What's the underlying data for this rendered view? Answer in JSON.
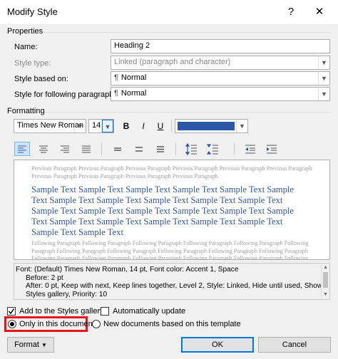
{
  "window": {
    "title": "Modify Style",
    "help": "?",
    "close": "✕"
  },
  "properties": {
    "section_label": "Properties",
    "name_label": "Name:",
    "name_value": "Heading 2",
    "style_type_label": "Style type:",
    "style_type_value": "Linked (paragraph and character)",
    "based_on_label": "Style based on:",
    "based_on_value": "Normal",
    "following_label": "Style for following paragraph:",
    "following_value": "Normal"
  },
  "formatting": {
    "section_label": "Formatting",
    "font": "Times New Roman",
    "size": "14",
    "bold": "B",
    "italic": "I",
    "underline": "U",
    "font_color": "#2e56a6"
  },
  "preview": {
    "previous": "Previous Paragraph Previous Paragraph Previous Paragraph Previous Paragraph Previous Paragraph Previous Paragraph Previous Paragraph Previous Paragraph Previous Paragraph Previous Paragraph",
    "sample": "Sample Text Sample Text Sample Text Sample Text Sample Text Sample Text Sample Text Sample Text Sample Text Sample Text Sample Text Sample Text Sample Text Sample Text Sample Text Sample Text Sample Text Sample Text Sample Text Sample Text Sample Text Sample Text Sample Text Sample Text",
    "following": "Following Paragraph Following Paragraph Following Paragraph Following Paragraph Following Paragraph Following Paragraph Following Paragraph Following Paragraph Following Paragraph Following Paragraph Following Paragraph Following Paragraph Following Paragraph Following Paragraph Following Paragraph Following Paragraph Following Paragraph Following Paragraph Following Paragraph Following Paragraph"
  },
  "description": {
    "line1": "Font: (Default) Times New Roman, 14 pt, Font color: Accent 1, Space",
    "line2": "Before:  2 pt",
    "line3": "After:  0 pt, Keep with next, Keep lines together, Level 2, Style: Linked, Hide until used, Show in the",
    "line4": "Styles gallery, Priority: 10"
  },
  "options": {
    "add_gallery": "Add to the Styles gallery",
    "auto_update": "Automatically update",
    "only_doc": "Only in this document",
    "new_docs": "New documents based on this template"
  },
  "buttons": {
    "format": "Format",
    "ok": "OK",
    "cancel": "Cancel"
  },
  "colors": {
    "highlight": "#e8141c",
    "accent": "#2e56a6"
  }
}
